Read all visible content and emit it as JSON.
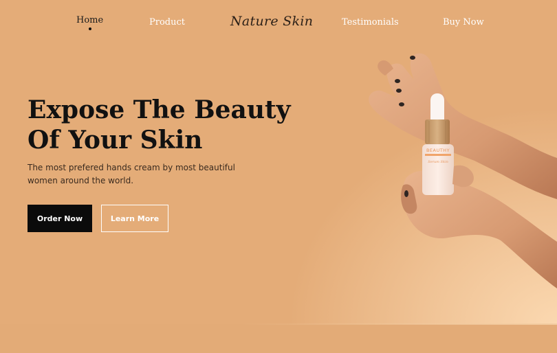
{
  "nav": {
    "items": [
      {
        "label": "Home",
        "active": true
      },
      {
        "label": "Product",
        "active": false
      },
      {
        "label": "Testimonials",
        "active": false
      },
      {
        "label": "Buy Now",
        "active": false
      }
    ],
    "brand": "Nature Skin"
  },
  "hero": {
    "title_line1": "Expose The Beauty",
    "title_line2": "Of Your Skin",
    "subtitle": "The most prefered hands cream by most beautiful women around the world.",
    "primary_button": "Order Now",
    "secondary_button": "Learn More"
  },
  "product": {
    "bottle_label": "BEAUTHY",
    "bottle_sublabel": "Serum Skin"
  },
  "colors": {
    "background": "#e4ac78",
    "glow": "#fbd8b0",
    "dark": "#0b0b0b",
    "light": "#ffffff"
  }
}
